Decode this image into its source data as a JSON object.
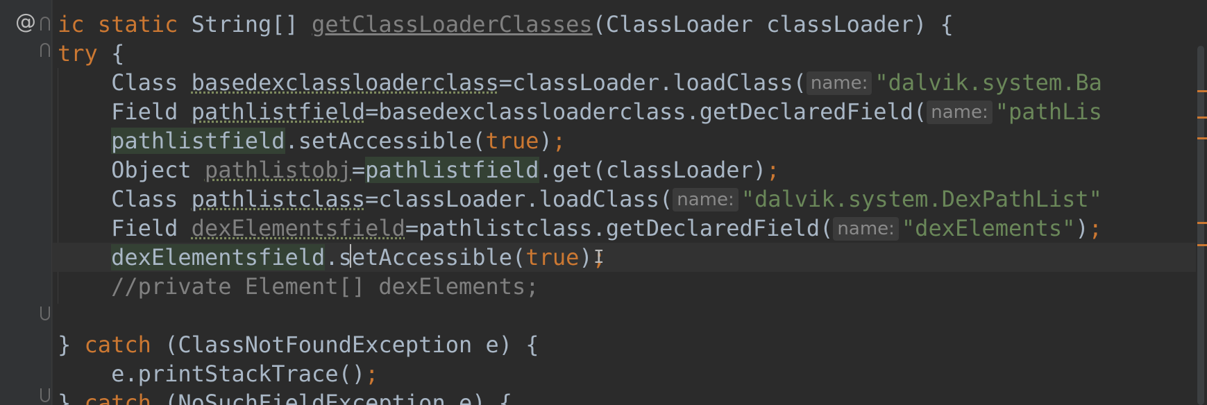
{
  "editor": {
    "annotation_marker": "@",
    "lines": [
      {
        "parts": [
          [
            "kw",
            "ic static "
          ],
          [
            "",
            "String[] "
          ],
          [
            "method",
            "getClassLoaderClasses"
          ],
          [
            "",
            "(ClassLoader classLoader) {"
          ]
        ]
      },
      {
        "parts": [
          [
            "kw",
            "try "
          ],
          [
            "",
            "{"
          ]
        ]
      },
      {
        "indent": 2,
        "parts": [
          [
            "",
            "Class "
          ],
          [
            "ul",
            "basedexclassloaderclass"
          ],
          [
            "",
            "=classLoader.loadClass("
          ],
          [
            "hint",
            "name:"
          ],
          [
            "str",
            "\"dalvik.system.Ba"
          ]
        ]
      },
      {
        "indent": 2,
        "parts": [
          [
            "",
            "Field "
          ],
          [
            "ul",
            "pathlistfield"
          ],
          [
            "",
            "=basedexclassloaderclass.getDeclaredField("
          ],
          [
            "hint",
            "name:"
          ],
          [
            "str",
            "\"pathLis"
          ]
        ]
      },
      {
        "indent": 2,
        "parts": [
          [
            "field",
            "pathlistfield"
          ],
          [
            "",
            ".setAccessible("
          ],
          [
            "kw",
            "true"
          ],
          [
            "",
            ")"
          ],
          [
            "kw",
            ";"
          ]
        ]
      },
      {
        "indent": 2,
        "parts": [
          [
            "",
            "Object "
          ],
          [
            "unusedul",
            "pathlistobj"
          ],
          [
            "",
            "="
          ],
          [
            "field",
            "pathlistfield"
          ],
          [
            "",
            ".get(classLoader)"
          ],
          [
            "kw",
            ";"
          ]
        ]
      },
      {
        "indent": 2,
        "parts": [
          [
            "",
            "Class "
          ],
          [
            "ul",
            "pathlistclass"
          ],
          [
            "",
            "=classLoader.loadClass("
          ],
          [
            "hint",
            "name:"
          ],
          [
            "str",
            "\"dalvik.system.DexPathList\""
          ]
        ]
      },
      {
        "indent": 2,
        "parts": [
          [
            "",
            "Field "
          ],
          [
            "unusedul",
            "dexElementsfield"
          ],
          [
            "",
            "=pathlistclass.getDeclaredField("
          ],
          [
            "hint",
            "name:"
          ],
          [
            "str",
            "\"dexElements\""
          ],
          [
            "",
            ")"
          ],
          [
            "kw",
            ";"
          ]
        ]
      },
      {
        "indent": 2,
        "current": true,
        "parts": [
          [
            "field",
            "dexElementsfield"
          ],
          [
            "",
            ".setAccessible("
          ],
          [
            "kw",
            "true"
          ],
          [
            "",
            ")"
          ],
          [
            "kw",
            ";"
          ]
        ]
      },
      {
        "indent": 2,
        "parts": [
          [
            "cmt",
            "//private Element[] dexElements;"
          ]
        ]
      },
      {
        "parts": []
      },
      {
        "parts": [
          [
            "",
            "} "
          ],
          [
            "kw",
            "catch "
          ],
          [
            "",
            "(ClassNotFoundException e) {"
          ]
        ]
      },
      {
        "indent": 2,
        "parts": [
          [
            "",
            "e.printStackTrace()"
          ],
          [
            "kw",
            ";"
          ]
        ]
      },
      {
        "parts": [
          [
            "",
            "} "
          ],
          [
            "kw",
            "catch "
          ],
          [
            "",
            "(NoSuchFieldException e) {"
          ]
        ]
      }
    ]
  },
  "colors": {
    "background": "#2b2b2b",
    "keyword": "#cc7832",
    "string": "#6a8759",
    "comment": "#808080",
    "text": "#a9b7c6"
  }
}
